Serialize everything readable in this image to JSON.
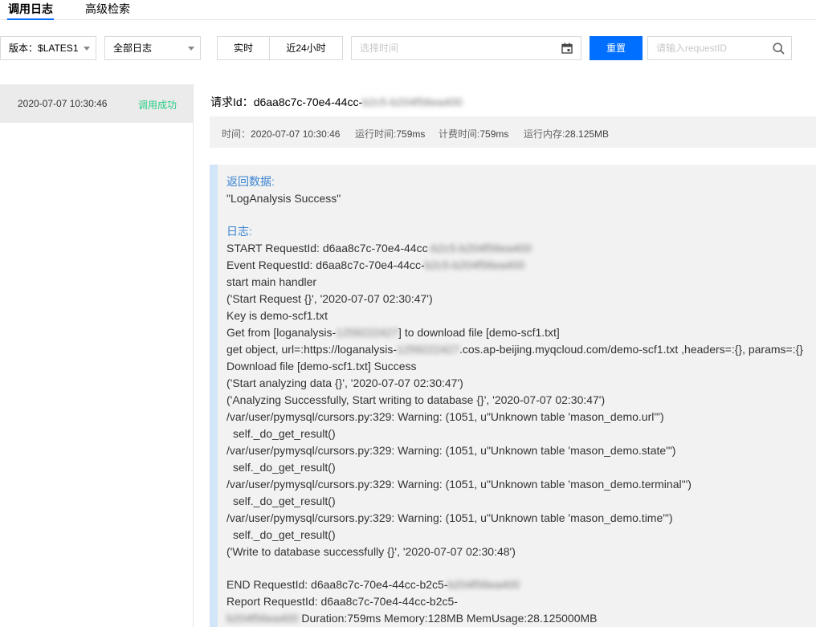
{
  "tabs": {
    "invoke_log": "调用日志",
    "advanced_search": "高级检索"
  },
  "toolbar": {
    "version_label": "版本：",
    "version_value": "$LATES1",
    "log_type_value": "全部日志",
    "realtime_label": "实时",
    "last24h_label": "近24小时",
    "date_placeholder": "选择时间",
    "reset_label": "重置",
    "request_id_placeholder": "请输入requestID"
  },
  "log_list": [
    {
      "time": "2020-07-07 10:30:46",
      "status": "调用成功"
    }
  ],
  "detail": {
    "request_id_label": "请求Id：",
    "request_id_visible": "d6aa8c7c-70e4-44cc-",
    "request_id_hidden": "b2c5-b204f56ea400",
    "meta": {
      "time_label": "时间：",
      "time_value": "2020-07-07 10:30:46",
      "duration_label": "运行时间:",
      "duration_value": "759ms",
      "billed_label": "计费时间:",
      "billed_value": "759ms",
      "memory_label": "运行内存:",
      "memory_value": "28.125MB"
    }
  },
  "log": {
    "return_label": "返回数据:",
    "return_value": "\"LogAnalysis Success\"",
    "log_label": "日志:",
    "start_prefix": "START RequestId: d6aa8c7c-70e4-44cc",
    "start_hidden": "-b2c5-b204f56ea400",
    "event_prefix": "Event RequestId: d6aa8c7c-70e4-44cc-",
    "event_hidden": "b2c5-b204f56ea400",
    "l_handler": "start main handler",
    "l_start_req": "('Start Request {}', '2020-07-07 02:30:47')",
    "l_key": "Key is demo-scf1.txt",
    "get_from_prefix": "Get from [loganalysis-",
    "get_from_hidden": "1259222427",
    "get_from_suffix": "] to download file [demo-scf1.txt]",
    "get_obj_prefix": "get object, url=:https://loganalysis-",
    "get_obj_hidden": "1259222427",
    "get_obj_suffix": ".cos.ap-beijing.myqcloud.com/demo-scf1.txt ,headers=:{}, params=:{}",
    "l_download": "Download file [demo-scf1.txt] Success",
    "l_analyzing": "('Start analyzing data {}', '2020-07-07 02:30:47')",
    "l_analyzed": "('Analyzing Successfully, Start writing to database {}', '2020-07-07 02:30:47')",
    "w_url": "/var/user/pymysql/cursors.py:329: Warning: (1051, u\"Unknown table 'mason_demo.url'\")",
    "w_state": "/var/user/pymysql/cursors.py:329: Warning: (1051, u\"Unknown table 'mason_demo.state'\")",
    "w_terminal": "/var/user/pymysql/cursors.py:329: Warning: (1051, u\"Unknown table 'mason_demo.terminal'\")",
    "w_time": "/var/user/pymysql/cursors.py:329: Warning: (1051, u\"Unknown table 'mason_demo.time'\")",
    "self_get": "self._do_get_result()",
    "l_write": "('Write to database successfully {}', '2020-07-07 02:30:48')",
    "end_prefix": "END RequestId: d6aa8c7c-70e4-44cc-b2c5-",
    "end_hidden": "b204f56ea400",
    "report_prefix": "Report RequestId: d6aa8c7c-70e4-44cc-b2c5-",
    "report_hidden": "b204f56ea400",
    "report_suffix": " Duration:759ms Memory:128MB MemUsage:28.125000MB"
  },
  "colors": {
    "accent": "#006eff",
    "success": "#29cc85",
    "log_heading": "#3b84d1",
    "log_border": "#d3e5f8"
  },
  "icons": {
    "calendar": "calendar-icon",
    "search": "search-icon",
    "dropdown": "chevron-down-icon"
  }
}
